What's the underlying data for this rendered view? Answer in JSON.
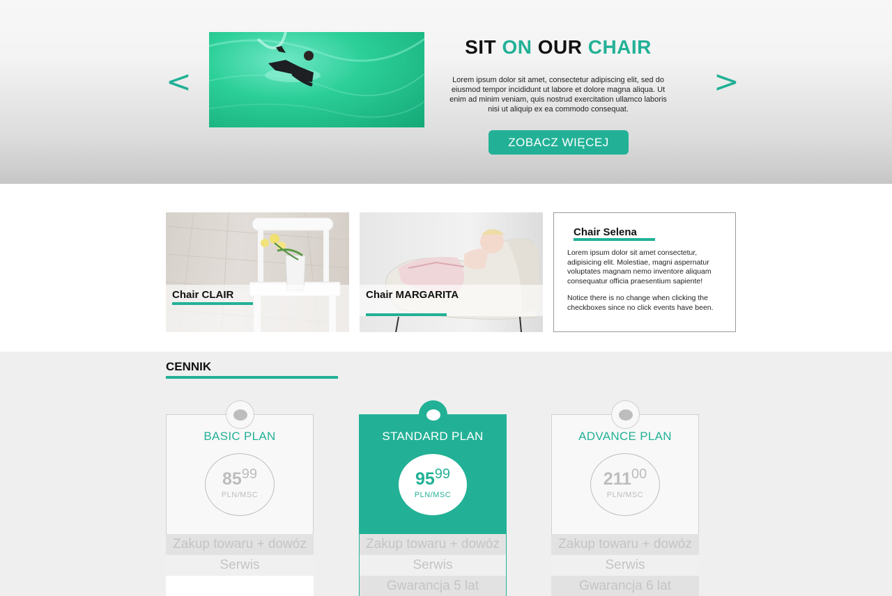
{
  "hero": {
    "title_part1": "SIT ",
    "title_part2": "ON",
    "title_part3": " OUR ",
    "title_part4": "CHAIR",
    "text": "Lorem ipsum dolor sit amet, consectetur adipiscing elit, sed do eiusmod tempor incididunt ut labore et dolore magna aliqua. Ut enim ad minim veniam, quis nostrud exercitation ullamco laboris nisi ut aliquip ex ea commodo consequat.",
    "button": "ZOBACZ WIĘCEJ",
    "prev_arrow": "<",
    "next_arrow": ">"
  },
  "cards": {
    "card1_label": "Chair CLAIR",
    "card2_label": "Chair MARGARITA",
    "card3_title": "Chair Selena",
    "card3_text": "Lorem ipsum dolor sit amet consectetur, adipisicing elit. Molestiae, magni aspernatur voluptates magnam nemo inventore aliquam consequatur officia praesentium sapiente!",
    "card3_text2": "Notice there is no change when clicking the checkboxes since no click events have been."
  },
  "pricing": {
    "heading": "CENNIK",
    "plans": [
      {
        "name": "BASIC PLAN",
        "price_main": "85",
        "price_cents": "99",
        "unit": "PLN/MSC",
        "features": [
          "Zakup towaru + dowóz",
          "Serwis",
          ""
        ]
      },
      {
        "name": "STANDARD PLAN",
        "price_main": "95",
        "price_cents": "99",
        "unit": "PLN/MSC",
        "features": [
          "Zakup towaru + dowóz",
          "Serwis",
          "Gwarancja 5 lat"
        ]
      },
      {
        "name": "ADVANCE PLAN",
        "price_main": "211",
        "price_cents": "00",
        "unit": "PLN/MSC",
        "features": [
          "Zakup towaru + dowóz",
          "Serwis",
          "Gwarancja 6 lat"
        ]
      }
    ]
  },
  "colors": {
    "accent": "#22b196"
  }
}
